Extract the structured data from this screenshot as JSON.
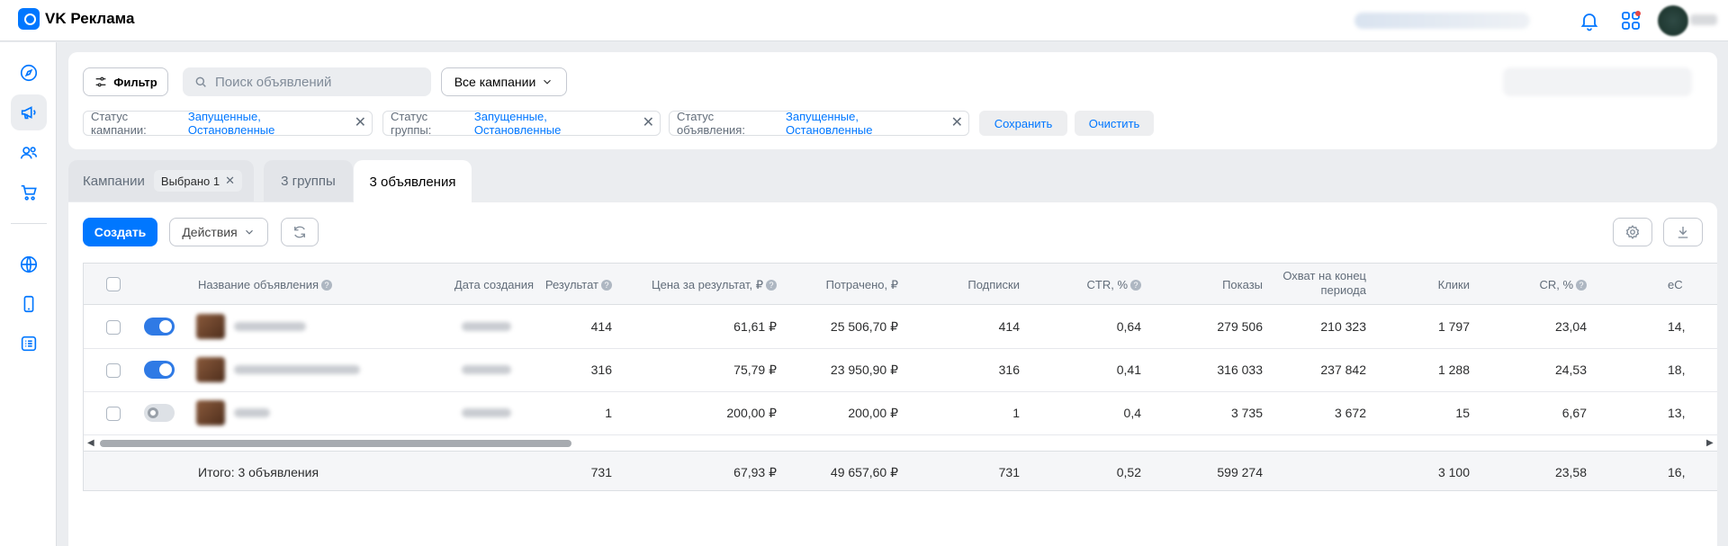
{
  "app": {
    "title": "VK Реклама"
  },
  "header": {
    "icons": [
      "bell-icon",
      "apps-icon"
    ],
    "accent": "#0077ff"
  },
  "sidebar": {
    "items": [
      {
        "icon": "compass-icon",
        "active": false
      },
      {
        "icon": "megaphone-icon",
        "active": true
      },
      {
        "icon": "audience-icon",
        "active": false
      },
      {
        "icon": "cart-icon",
        "active": false
      },
      {
        "icon": "globe-icon",
        "active": false
      },
      {
        "icon": "phone-icon",
        "active": false
      },
      {
        "icon": "list-icon",
        "active": false
      }
    ]
  },
  "filters": {
    "filter_label": "Фильтр",
    "search_placeholder": "Поиск объявлений",
    "campaigns_select": "Все кампании",
    "chips": [
      {
        "label": "Статус кампании:",
        "value": "Запущенные, Остановленные"
      },
      {
        "label": "Статус группы:",
        "value": "Запущенные, Остановленные"
      },
      {
        "label": "Статус объявления:",
        "value": "Запущенные, Остановленные"
      }
    ],
    "save_label": "Сохранить",
    "clear_label": "Очистить"
  },
  "tabs": {
    "campaigns": "Кампании",
    "selected": "Выбрано 1",
    "groups": "3 группы",
    "ads": "3 объявления"
  },
  "toolbar": {
    "create_label": "Создать",
    "actions_label": "Действия"
  },
  "table": {
    "headers": {
      "name": "Название объявления",
      "date": "Дата создания",
      "result": "Результат",
      "price": "Цена за результат, ₽",
      "spent": "Потрачено, ₽",
      "subs": "Подписки",
      "ctr": "CTR, %",
      "shows": "Показы",
      "reach": "Охват на конец периода",
      "clicks": "Клики",
      "cr": "CR, %",
      "ecpm": "eC"
    },
    "rows": [
      {
        "enabled": true,
        "result": "414",
        "price": "61,61 ₽",
        "spent": "25 506,70 ₽",
        "subs": "414",
        "ctr": "0,64",
        "shows": "279 506",
        "reach": "210 323",
        "clicks": "1 797",
        "cr": "23,04",
        "ecpm": "14,"
      },
      {
        "enabled": true,
        "result": "316",
        "price": "75,79 ₽",
        "spent": "23 950,90 ₽",
        "subs": "316",
        "ctr": "0,41",
        "shows": "316 033",
        "reach": "237 842",
        "clicks": "1 288",
        "cr": "24,53",
        "ecpm": "18,"
      },
      {
        "enabled": false,
        "result": "1",
        "price": "200,00 ₽",
        "spent": "200,00 ₽",
        "subs": "1",
        "ctr": "0,4",
        "shows": "3 735",
        "reach": "3 672",
        "clicks": "15",
        "cr": "6,67",
        "ecpm": "13,"
      }
    ],
    "total": {
      "label": "Итого: 3 объявления",
      "result": "731",
      "price": "67,93 ₽",
      "spent": "49 657,60 ₽",
      "subs": "731",
      "ctr": "0,52",
      "shows": "599 274",
      "reach": "",
      "clicks": "3 100",
      "cr": "23,58",
      "ecpm": "16,"
    }
  }
}
